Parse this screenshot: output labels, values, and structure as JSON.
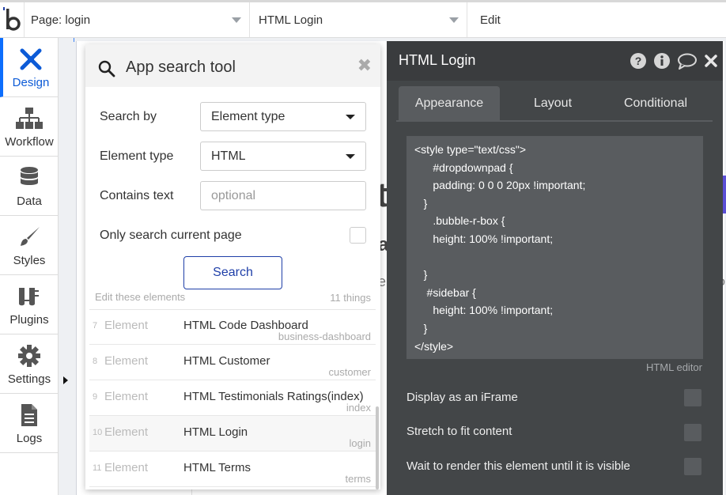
{
  "topbar": {
    "logo": "bubble-logo",
    "page_selector": "Page: login",
    "element_selector": "HTML Login",
    "mode": "Edit"
  },
  "sidebar": {
    "items": [
      {
        "label": "Design",
        "icon": "design-icon",
        "active": true
      },
      {
        "label": "Workflow",
        "icon": "workflow-icon",
        "active": false
      },
      {
        "label": "Data",
        "icon": "database-icon",
        "active": false
      },
      {
        "label": "Styles",
        "icon": "brush-icon",
        "active": false
      },
      {
        "label": "Plugins",
        "icon": "plug-icon",
        "active": false
      },
      {
        "label": "Settings",
        "icon": "gear-icon",
        "active": false
      },
      {
        "label": "Logs",
        "icon": "document-icon",
        "active": false
      }
    ]
  },
  "search_tool": {
    "title": "App search tool",
    "search_by_label": "Search by",
    "search_by_value": "Element type",
    "element_type_label": "Element type",
    "element_type_value": "HTML",
    "contains_text_label": "Contains text",
    "contains_text_placeholder": "optional",
    "contains_text_value": "",
    "only_current_page_label": "Only search current page",
    "only_current_page_checked": false,
    "search_button": "Search",
    "edit_label": "Edit these elements",
    "count_label": "11 things",
    "results": [
      {
        "num": "7",
        "type": "Element",
        "name": "HTML Code Dashboard",
        "page": "business-dashboard",
        "selected": false
      },
      {
        "num": "8",
        "type": "Element",
        "name": "HTML Customer",
        "page": "customer",
        "selected": false
      },
      {
        "num": "9",
        "type": "Element",
        "name": "HTML Testimonials Ratings(index)",
        "page": "index",
        "selected": false
      },
      {
        "num": "10",
        "type": "Element",
        "name": "HTML Login",
        "page": "login",
        "selected": true
      },
      {
        "num": "11",
        "type": "Element",
        "name": "HTML Terms",
        "page": "terms",
        "selected": false
      }
    ]
  },
  "property_editor": {
    "title": "HTML Login",
    "header_icons": [
      "help-icon",
      "info-icon",
      "comment-icon",
      "close-icon"
    ],
    "tabs": [
      {
        "label": "Appearance",
        "active": true
      },
      {
        "label": "Layout",
        "active": false
      },
      {
        "label": "Conditional",
        "active": false
      }
    ],
    "html_code": "<style type=\"text/css\">\n      #dropdownpad {\n      padding: 0 0 0 20px !important;\n   }\n      .bubble-r-box {\n      height: 100% !important;\n\n   }\n    #sidebar {\n      height: 100% !important;\n   }\n</style>",
    "html_editor_label": "HTML editor",
    "options": [
      {
        "label": "Display as an iFrame",
        "checked": false
      },
      {
        "label": "Stretch to fit content",
        "checked": false
      },
      {
        "label": "Wait to render this element until it is visible",
        "checked": false
      }
    ]
  },
  "colors": {
    "accent": "#0d6efd",
    "panel_dark": "#434648",
    "button_border": "#1f3fa8"
  }
}
